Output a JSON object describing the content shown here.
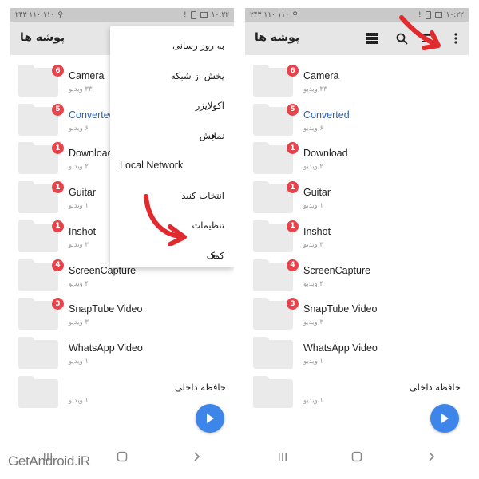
{
  "status_bar": {
    "time": "۱۰:۲۲",
    "signal_text": "۲۴۳ ۱۱۰ ۱۱۰"
  },
  "toolbar": {
    "title": "پوشه ها"
  },
  "folders": [
    {
      "name": "Camera",
      "count": "۳۳ ویدیو",
      "badge": "6",
      "highlight": false
    },
    {
      "name": "Converted",
      "count": "۶ ویدیو",
      "badge": "5",
      "highlight": true
    },
    {
      "name": "Download",
      "count": "۲ ویدیو",
      "badge": "1",
      "highlight": false
    },
    {
      "name": "Guitar",
      "count": "۱ ویدیو",
      "badge": "1",
      "highlight": false
    },
    {
      "name": "Inshot",
      "count": "۳ ویدیو",
      "badge": "1",
      "highlight": false
    },
    {
      "name": "ScreenCapture",
      "count": "۴ ویدیو",
      "badge": "4",
      "highlight": false
    },
    {
      "name": "SnapTube Video",
      "count": "۳ ویدیو",
      "badge": "3",
      "highlight": false
    },
    {
      "name": "WhatsApp Video",
      "count": "۱ ویدیو",
      "badge": "",
      "highlight": false
    },
    {
      "name": "حافظه داخلی",
      "count": "۱ ویدیو",
      "badge": "",
      "highlight": false
    }
  ],
  "menu": {
    "items": [
      {
        "label": "به روز رسانی",
        "has_submenu": false
      },
      {
        "label": "پخش از شبکه",
        "has_submenu": false
      },
      {
        "label": "اکولایزر",
        "has_submenu": false
      },
      {
        "label": "نمایش",
        "has_submenu": true
      },
      {
        "label": "Local Network",
        "has_submenu": false
      },
      {
        "label": "انتخاب کنید",
        "has_submenu": false
      },
      {
        "label": "تنظیمات",
        "has_submenu": false
      },
      {
        "label": "کمک",
        "has_submenu": true
      }
    ]
  },
  "icons": {
    "grid": "grid-view-icon",
    "search": "search-icon",
    "sort": "sort-icon",
    "overflow": "overflow-menu-icon",
    "play": "play-icon",
    "annotation_arrow": "red-arrow-annotation-icon"
  },
  "watermark": "GetAndroid.iR",
  "colors": {
    "badge": "#e8434b",
    "fab": "#3d85e8",
    "highlight": "#2a62b8",
    "arrow": "#e12a2e",
    "toolbar": "#e6e6e6",
    "status_bar": "#c9c9c9"
  }
}
